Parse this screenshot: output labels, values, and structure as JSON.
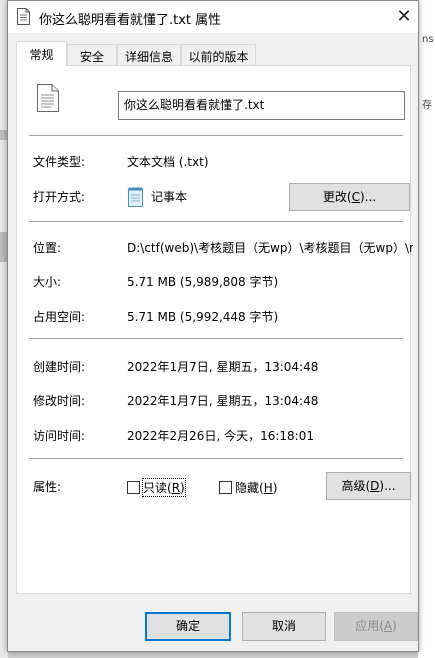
{
  "window": {
    "title": "你这么聪明看看就懂了.txt 属性",
    "close_glyph": "✕",
    "file_icon": "document-icon"
  },
  "tabs": [
    {
      "label": "常规",
      "active": true
    },
    {
      "label": "安全",
      "active": false
    },
    {
      "label": "详细信息",
      "active": false
    },
    {
      "label": "以前的版本",
      "active": false
    }
  ],
  "general": {
    "filename": "你这么聪明看看就懂了.txt",
    "type_label": "文件类型:",
    "type_value": "文本文档 (.txt)",
    "open_with_label": "打开方式:",
    "open_with_value": "记事本",
    "open_with_icon": "notepad-icon",
    "change_button": {
      "text": "更改(",
      "key": "C",
      "suffix": ")..."
    },
    "location_label": "位置:",
    "location_value": "D:\\ctf(web)\\考核题目（无wp）\\考核题目（无wp）\\n",
    "size_label": "大小:",
    "size_value": "5.71 MB (5,989,808 字节)",
    "disk_size_label": "占用空间:",
    "disk_size_value": "5.71 MB (5,992,448 字节)",
    "created_label": "创建时间:",
    "created_value": "2022年1月7日, 星期五，13:04:48",
    "modified_label": "修改时间:",
    "modified_value": "2022年1月7日, 星期五，13:04:48",
    "accessed_label": "访问时间:",
    "accessed_value": "2022年2月26日, 今天，16:18:01",
    "attributes_label": "属性:",
    "readonly": {
      "text": "只读(",
      "key": "R",
      "suffix": ")",
      "checked": false
    },
    "hidden": {
      "text": "隐藏(",
      "key": "H",
      "suffix": ")",
      "checked": false
    },
    "advanced_button": {
      "text": "高级(",
      "key": "D",
      "suffix": ")..."
    }
  },
  "footer": {
    "ok": "确定",
    "cancel": "取消",
    "apply": {
      "text": "应用(",
      "key": "A",
      "suffix": ")"
    }
  },
  "background": {
    "right_fragment_1": "ns",
    "right_fragment_2": "存"
  }
}
